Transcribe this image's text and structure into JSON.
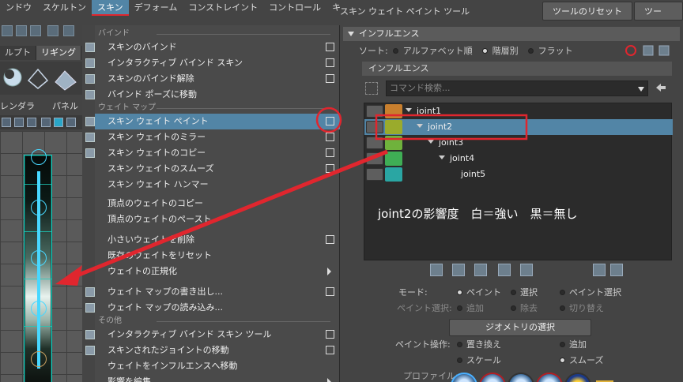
{
  "menubar": {
    "items": [
      {
        "label": "ンドウ"
      },
      {
        "label": "スケルトン"
      },
      {
        "label": "スキン",
        "active": true
      },
      {
        "label": "デフォーム"
      },
      {
        "label": "コンストレイント"
      },
      {
        "label": "コントロール"
      },
      {
        "label": "キャッシュ"
      }
    ]
  },
  "left_strip": {
    "shelf_tabs": [
      "ルプト",
      "リギング"
    ],
    "panel_menu": [
      "レンダラ",
      "パネル"
    ]
  },
  "skin_menu": {
    "sections": {
      "bind": "バインド",
      "weight_map": "ウェイト マップ",
      "other": "その他"
    },
    "items": [
      {
        "label": "スキンのバインド",
        "suffix": "option"
      },
      {
        "label": "インタラクティブ バインド スキン",
        "suffix": "option"
      },
      {
        "label": "スキンのバインド解除",
        "suffix": "option"
      },
      {
        "label": "バインド ポーズに移動",
        "suffix": "none"
      },
      {
        "label": "スキン ウェイト ペイント",
        "suffix": "option",
        "highlighted": true
      },
      {
        "label": "スキン ウェイトのミラー",
        "suffix": "option"
      },
      {
        "label": "スキン ウェイトのコピー",
        "suffix": "option"
      },
      {
        "label": "スキン ウェイトのスムーズ",
        "suffix": "option"
      },
      {
        "label": "スキン ウェイト ハンマー",
        "suffix": "none"
      },
      {
        "label": "頂点のウェイトのコピー",
        "suffix": "none"
      },
      {
        "label": "頂点のウェイトのペースト",
        "suffix": "none"
      },
      {
        "label": "小さいウェイトを削除",
        "suffix": "option"
      },
      {
        "label": "既存のウェイトをリセット",
        "suffix": "none"
      },
      {
        "label": "ウェイトの正規化",
        "suffix": "submenu"
      },
      {
        "label": "ウェイト マップの書き出し...",
        "suffix": "option"
      },
      {
        "label": "ウェイト マップの読み込み...",
        "suffix": "none"
      },
      {
        "label": "インタラクティブ バインド スキン ツール",
        "suffix": "option"
      },
      {
        "label": "スキンされたジョイントの移動",
        "suffix": "option"
      },
      {
        "label": "ウェイトをインフルエンスへ移動",
        "suffix": "none"
      },
      {
        "label": "影響を編集",
        "suffix": "submenu"
      }
    ]
  },
  "tool": {
    "title": "スキン ウェイト ペイント ツール",
    "reset_button": "ツールのリセット",
    "help_button": "ツール ヘル",
    "influence_header": "インフルエンス",
    "sort_label": "ソート:",
    "sort_options": [
      "アルファベット順",
      "階層別",
      "フラット"
    ],
    "sort_selected": 1,
    "influence_sub_header": "インフルエンス",
    "search_placeholder": "コマンド検索...",
    "joints": [
      {
        "name": "joint1",
        "color": "#c87f2e",
        "depth": 0,
        "expanded": true
      },
      {
        "name": "joint2",
        "color": "#9aab2c",
        "depth": 1,
        "expanded": true,
        "selected": true
      },
      {
        "name": "joint3",
        "color": "#6fb23c",
        "depth": 2,
        "expanded": true
      },
      {
        "name": "joint4",
        "color": "#3fae55",
        "depth": 3,
        "expanded": true
      },
      {
        "name": "joint5",
        "color": "#2aa6a3",
        "depth": 4,
        "expanded": false
      }
    ],
    "annotation": "joint2の影響度　白＝強い　黒＝無し",
    "mode_label": "モード:",
    "mode_options": [
      "ペイント",
      "選択",
      "ペイント選択"
    ],
    "mode_selected": 0,
    "paint_select_label": "ペイント選択:",
    "paint_select_options": [
      "追加",
      "除去",
      "切り替え"
    ],
    "geometry_button": "ジオメトリの選択",
    "paint_op_label": "ペイント操作:",
    "paint_op_options": [
      "置き換え",
      "追加",
      "スケール",
      "スムーズ"
    ],
    "paint_op_selected": 3,
    "profile_label": "プロファイル:"
  },
  "colors": {
    "accent": "#5285a6",
    "annotation_red": "#e0262e"
  }
}
